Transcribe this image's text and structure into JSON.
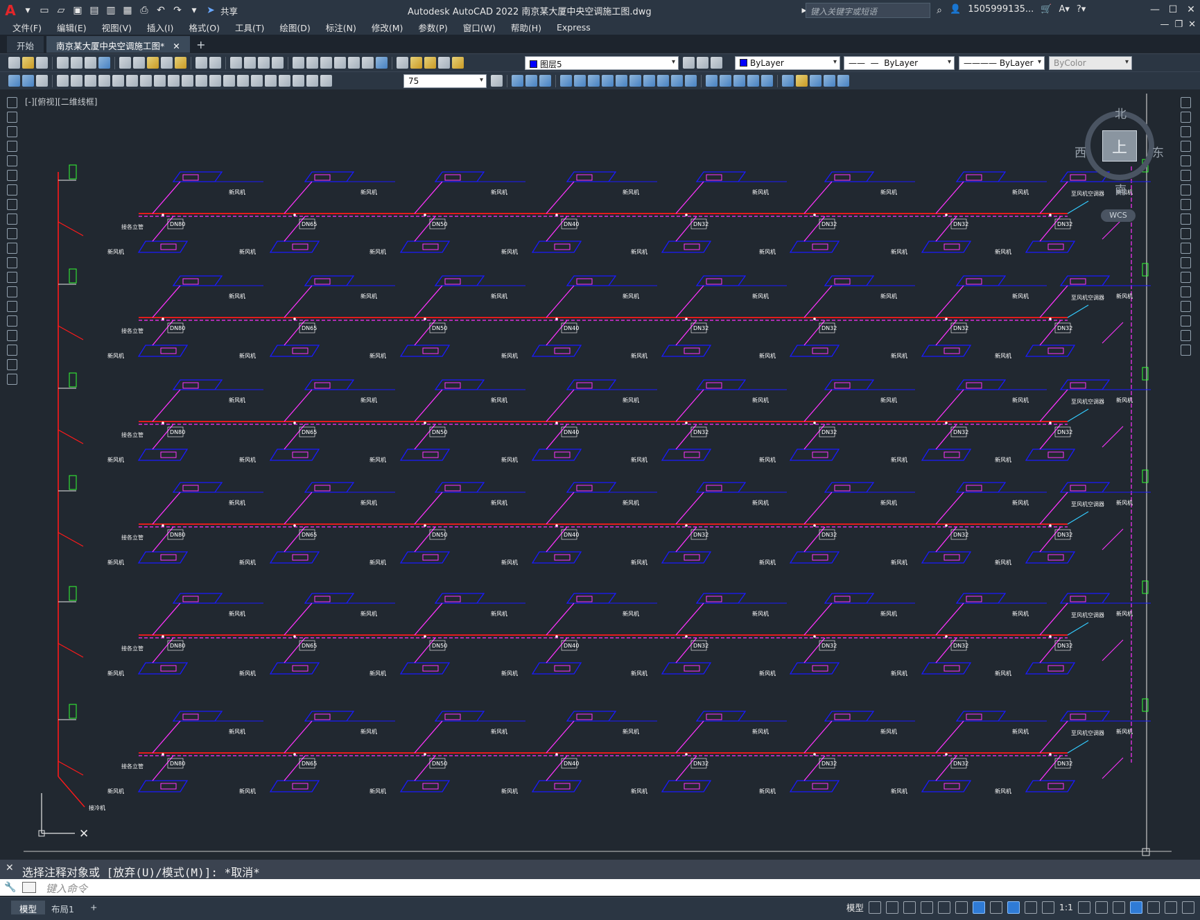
{
  "app": {
    "title": "Autodesk AutoCAD 2022    南京某大厦中央空调施工图.dwg",
    "share_label": "共享",
    "search_placeholder": "键入关键字或短语",
    "user": "1505999135..."
  },
  "menu": [
    "文件(F)",
    "编辑(E)",
    "视图(V)",
    "插入(I)",
    "格式(O)",
    "工具(T)",
    "绘图(D)",
    "标注(N)",
    "修改(M)",
    "参数(P)",
    "窗口(W)",
    "帮助(H)",
    "Express"
  ],
  "doc_tabs": [
    {
      "label": "开始"
    },
    {
      "label": "南京某大厦中央空调施工图*"
    }
  ],
  "toolbar": {
    "layer_name": "图层5",
    "layer_color": "#0000ff",
    "color_value": "ByLayer",
    "linetype_value": "ByLayer",
    "lineweight_value": "ByLayer",
    "plotstyle_value": "ByColor",
    "dim_scale": "75"
  },
  "viewport": {
    "view_label": "[-][俯视][二维线框]",
    "north": "北",
    "south": "南",
    "east": "东",
    "west": "西",
    "cube_face": "上",
    "wcs": "WCS",
    "ucs_y": "Y"
  },
  "drawing_labels": {
    "equipment": "新风机",
    "left_text": "接各立管",
    "right_text": "至风机空调器",
    "pipe_sizes": [
      "DN80",
      "DN65",
      "DN50",
      "DN40",
      "DN32"
    ],
    "bottom_note": "接冷机"
  },
  "command": {
    "history": "选择注释对象或 [放弃(U)/模式(M)]: *取消*",
    "placeholder": "键入命令"
  },
  "statusbar": {
    "tabs": [
      "模型",
      "布局1"
    ],
    "model_label": "模型",
    "scale": "1:1"
  },
  "colors": {
    "background": "#212830",
    "pipe_red": "#ff1a1a",
    "duct_blue": "#1a1aff",
    "magenta": "#ff33ff",
    "green": "#33ff33"
  }
}
